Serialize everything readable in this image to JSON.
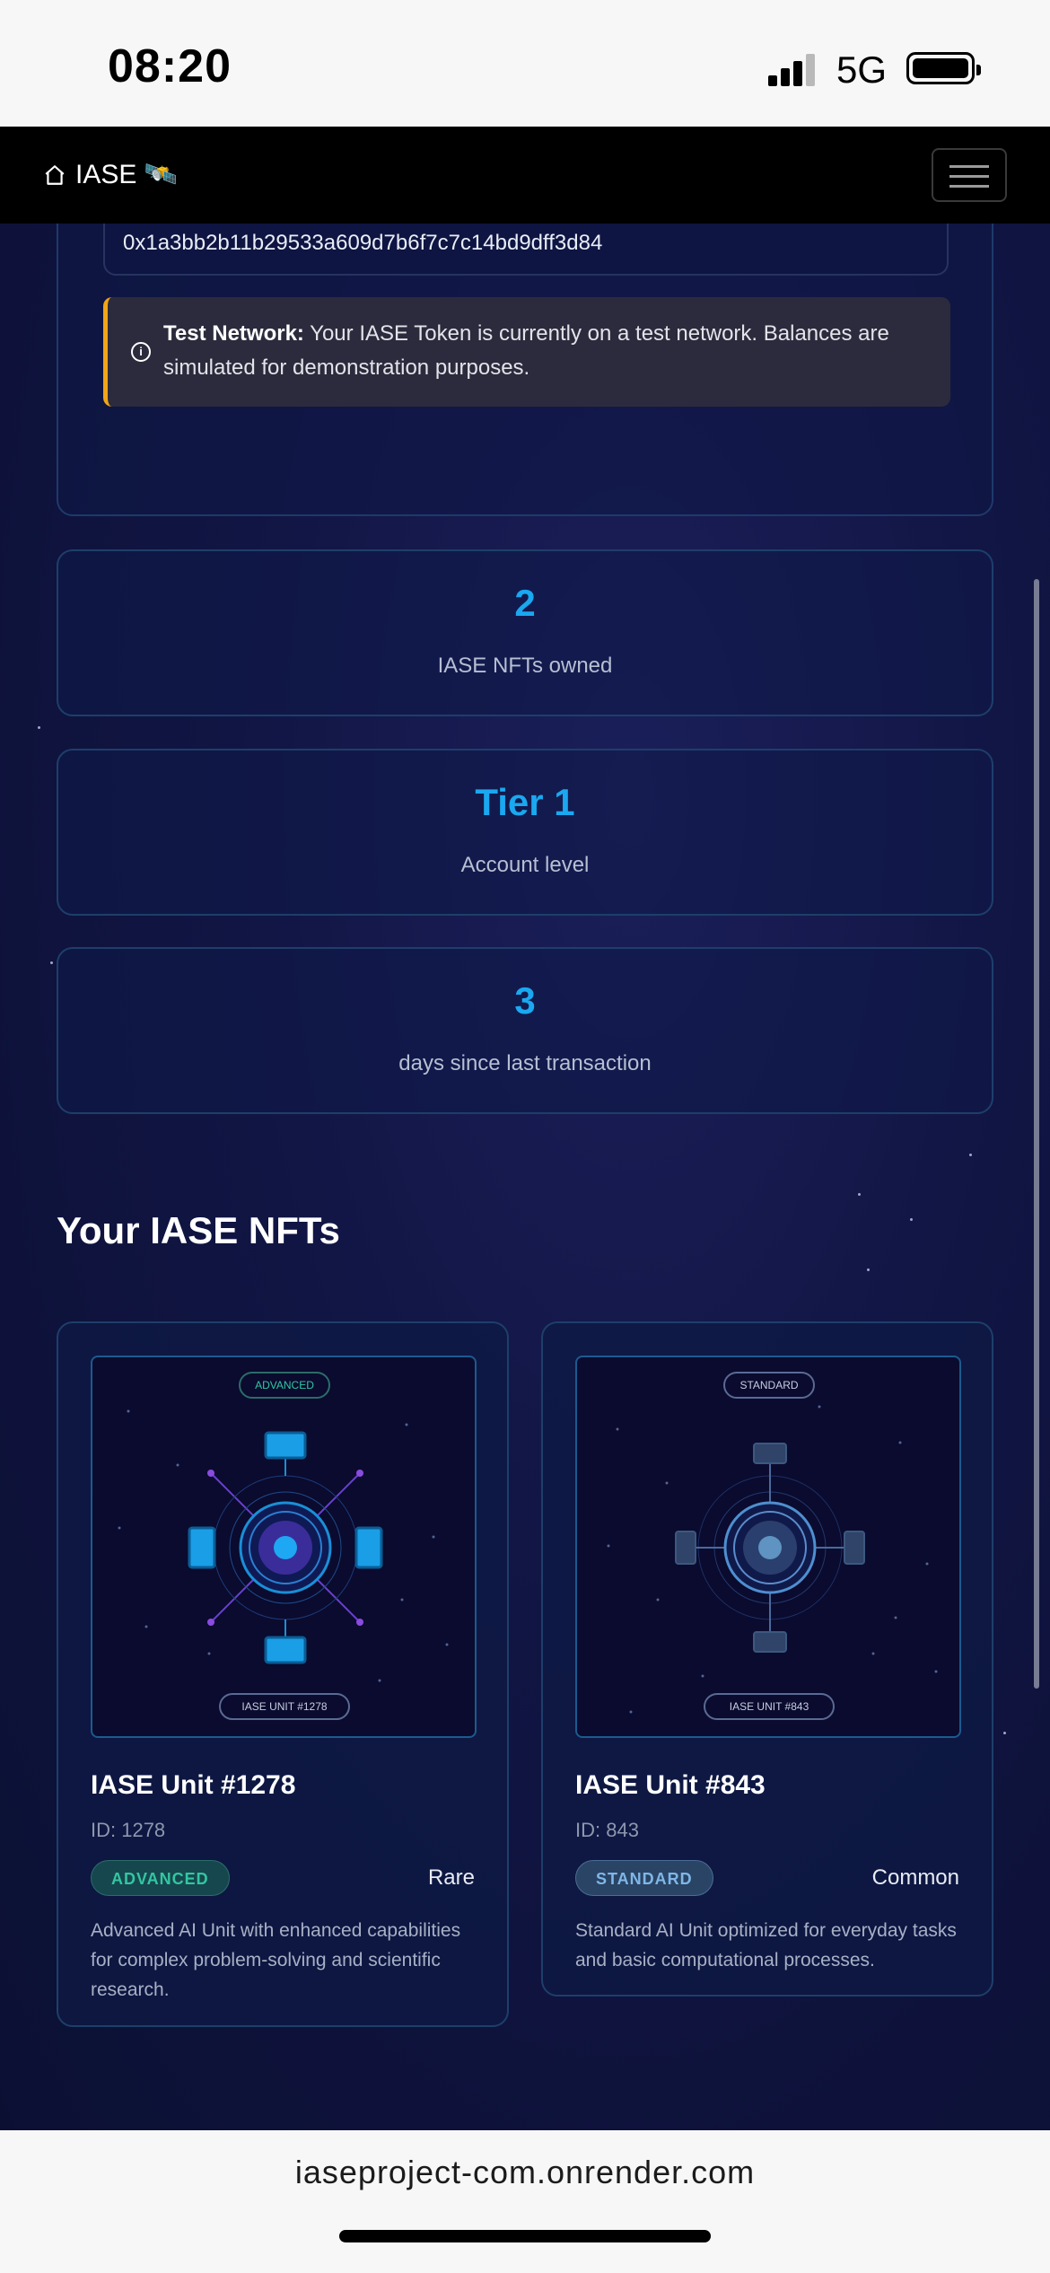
{
  "status_bar": {
    "time": "08:20",
    "network": "5G"
  },
  "navbar": {
    "brand": "IASE 🛰️"
  },
  "wallet": {
    "address": "0x1a3bb2b11b29533a609d7b6f7c7c14bd9dff3d84",
    "alert_title": "Test Network:",
    "alert_text": "Your IASE Token is currently on a test network. Balances are simulated for demonstration purposes."
  },
  "stats": [
    {
      "value": "2",
      "label": "IASE NFTs owned"
    },
    {
      "value": "Tier 1",
      "label": "Account level"
    },
    {
      "value": "3",
      "label": "days since last transaction"
    }
  ],
  "nft_section": {
    "title": "Your IASE NFTs",
    "items": [
      {
        "name": "IASE Unit #1278",
        "id": "ID: 1278",
        "badge": "ADVANCED",
        "rarity": "Rare",
        "description": "Advanced AI Unit with enhanced capabilities for complex problem-solving and scientific research.",
        "image_top_label": "ADVANCED",
        "image_bottom_label": "IASE UNIT #1278"
      },
      {
        "name": "IASE Unit #843",
        "id": "ID: 843",
        "badge": "STANDARD",
        "rarity": "Common",
        "description": "Standard AI Unit optimized for everyday tasks and basic computational processes.",
        "image_top_label": "STANDARD",
        "image_bottom_label": "IASE UNIT #843"
      }
    ]
  },
  "url_bar": {
    "url": "iaseproject-com.onrender.com"
  },
  "colors": {
    "accent": "#1aa8f0",
    "warning": "#f2a516",
    "advanced": "#33c6a0",
    "standard": "#7fb7e8"
  },
  "icons": {
    "home": "home-icon",
    "menu": "hamburger-menu-icon",
    "info": "info-icon",
    "satellite": "satellite-emoji"
  }
}
